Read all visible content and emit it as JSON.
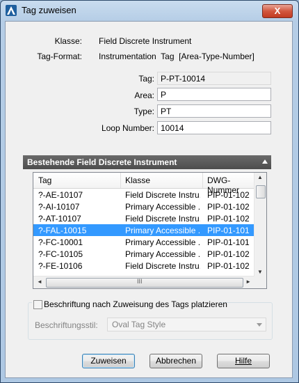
{
  "window": {
    "title": "Tag zuweisen",
    "close_label": "X"
  },
  "info": {
    "klasse_label": "Klasse:",
    "klasse_value": "Field Discrete Instrument",
    "tagformat_label": "Tag-Format:",
    "tagformat_value": "Instrumentation  Tag  [Area-Type-Number]"
  },
  "form": {
    "tag_label": "Tag:",
    "tag_value": "P-PT-10014",
    "area_label": "Area:",
    "area_value": "P",
    "type_label": "Type:",
    "type_value": "PT",
    "loop_label": "Loop Number:",
    "loop_value": "10014"
  },
  "section": {
    "title": "Bestehende Field Discrete Instrument"
  },
  "table": {
    "columns": [
      "Tag",
      "Klasse",
      "DWG-Nummer"
    ],
    "rows": [
      {
        "tag": "?-AE-10107",
        "klasse": "Field Discrete Instru...",
        "dwg": "PIP-01-102",
        "selected": false
      },
      {
        "tag": "?-AI-10107",
        "klasse": "Primary Accessible ...",
        "dwg": "PIP-01-102",
        "selected": false
      },
      {
        "tag": "?-AT-10107",
        "klasse": "Field Discrete Instru...",
        "dwg": "PIP-01-102",
        "selected": false
      },
      {
        "tag": "?-FAL-10015",
        "klasse": "Primary Accessible ...",
        "dwg": "PIP-01-101",
        "selected": true
      },
      {
        "tag": "?-FC-10001",
        "klasse": "Primary Accessible ...",
        "dwg": "PIP-01-101",
        "selected": false
      },
      {
        "tag": "?-FC-10105",
        "klasse": "Primary Accessible ...",
        "dwg": "PIP-01-102",
        "selected": false
      },
      {
        "tag": "?-FE-10106",
        "klasse": "Field Discrete Instru...",
        "dwg": "PIP-01-102",
        "selected": false
      }
    ],
    "hscroll_grip": "III"
  },
  "options": {
    "checkbox_label": "Beschriftung nach Zuweisung des Tags platzieren",
    "checkbox_checked": false,
    "style_label": "Beschriftungsstil:",
    "style_value": "Oval Tag Style"
  },
  "buttons": {
    "assign": "Zuweisen",
    "cancel": "Abbrechen",
    "help": "Hilfe"
  },
  "colors": {
    "selection": "#3399ff",
    "section_header": "#555555"
  }
}
